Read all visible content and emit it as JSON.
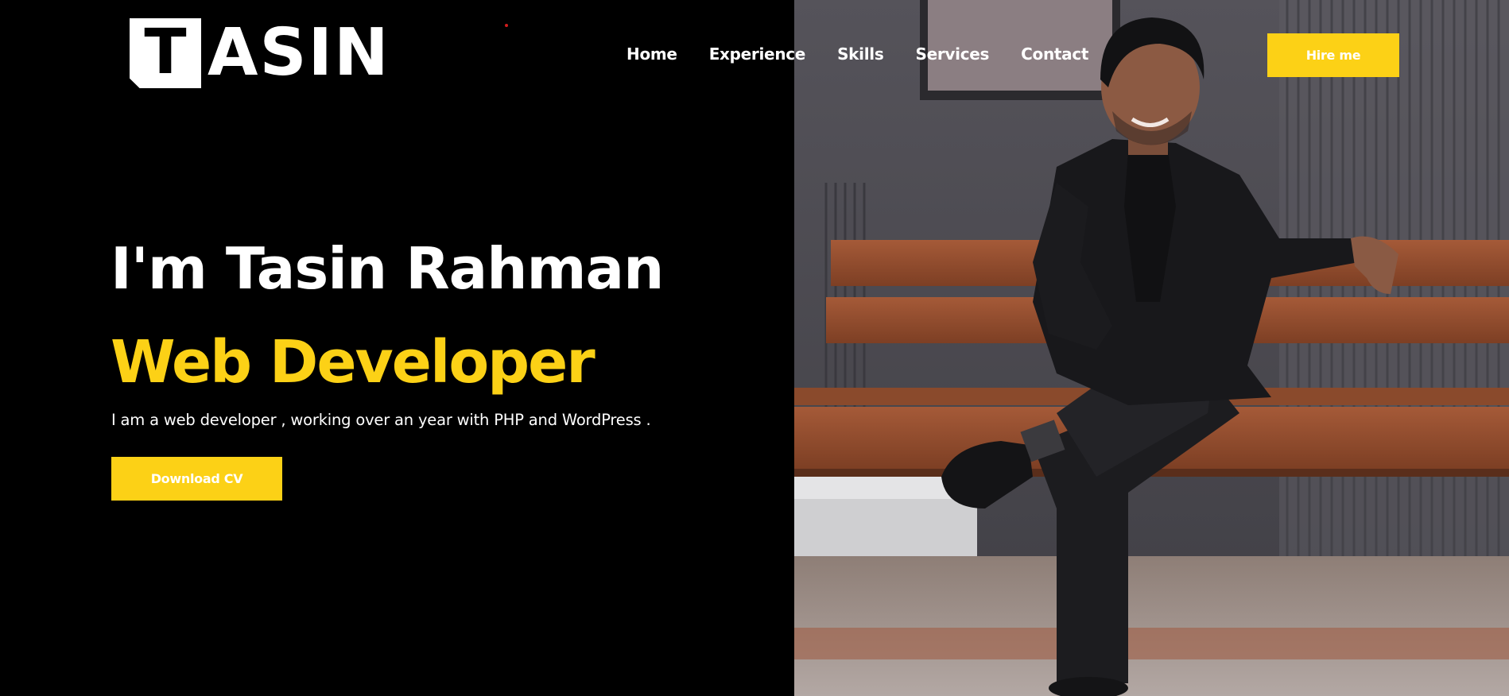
{
  "logo": {
    "letter_boxed": "T",
    "letters_rest": "ASIN"
  },
  "nav": {
    "items": [
      {
        "label": "Home"
      },
      {
        "label": "Experience"
      },
      {
        "label": "Skills"
      },
      {
        "label": "Services"
      },
      {
        "label": "Contact"
      }
    ]
  },
  "header": {
    "hire_label": "Hire me"
  },
  "hero": {
    "title": "I'm Tasin Rahman",
    "role": "Web Developer",
    "description": "I am a web developer , working over an year with PHP and WordPress .",
    "download_label": "Download CV"
  },
  "colors": {
    "accent": "#fcd116",
    "background": "#000000",
    "text": "#ffffff"
  },
  "photo": {
    "icon": "portrait-photo"
  }
}
